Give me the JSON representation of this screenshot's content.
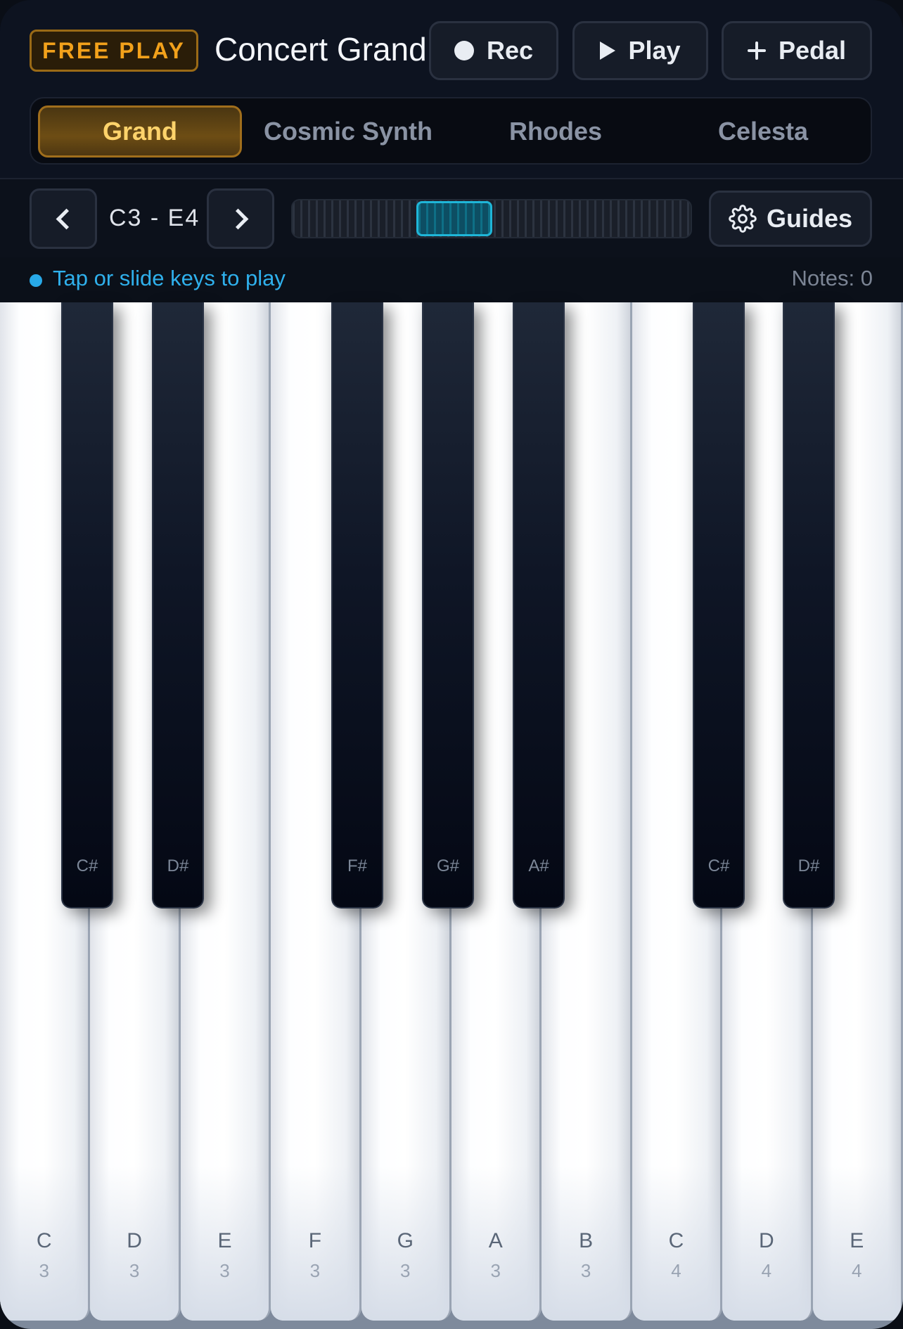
{
  "header": {
    "badge": "FREE PLAY",
    "title": "Concert Grand",
    "rec_label": "Rec",
    "play_label": "Play",
    "pedal_label": "Pedal"
  },
  "tabs": [
    {
      "label": "Grand",
      "active": true
    },
    {
      "label": "Cosmic Synth",
      "active": false
    },
    {
      "label": "Rhodes",
      "active": false
    },
    {
      "label": "Celesta",
      "active": false
    }
  ],
  "nav": {
    "range": "C3 - E4",
    "guides_label": "Guides"
  },
  "status": {
    "hint": "Tap or slide keys to play",
    "notes": "Notes: 0"
  },
  "keyboard": {
    "white_keys": [
      {
        "note": "C",
        "octave": "3"
      },
      {
        "note": "D",
        "octave": "3"
      },
      {
        "note": "E",
        "octave": "3"
      },
      {
        "note": "F",
        "octave": "3"
      },
      {
        "note": "G",
        "octave": "3"
      },
      {
        "note": "A",
        "octave": "3"
      },
      {
        "note": "B",
        "octave": "3"
      },
      {
        "note": "C",
        "octave": "4"
      },
      {
        "note": "D",
        "octave": "4"
      },
      {
        "note": "E",
        "octave": "4"
      }
    ],
    "black_keys": [
      {
        "note": "C#"
      },
      {
        "note": "D#"
      },
      {
        "note": "F#"
      },
      {
        "note": "G#"
      },
      {
        "note": "A#"
      },
      {
        "note": "C#"
      },
      {
        "note": "D#"
      }
    ]
  },
  "colors": {
    "accent": "#f2a11b",
    "highlight": "#1fb6d8"
  }
}
